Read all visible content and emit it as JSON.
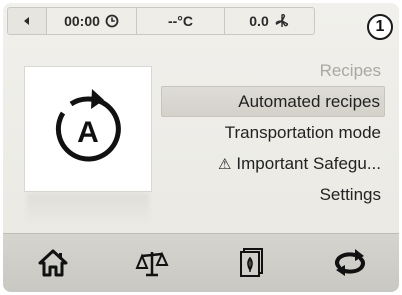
{
  "status_bar": {
    "timer": "00:00",
    "temperature": "--°C",
    "power": "0.0"
  },
  "step_badge": "1",
  "mode_tile": {
    "icon": "automated-mode-icon",
    "letter": "A"
  },
  "menu": {
    "items": [
      {
        "label": "Recipes"
      },
      {
        "label": "Automated recipes"
      },
      {
        "label": "Transportation mode"
      },
      {
        "label": "Important Safegu..."
      },
      {
        "label": "Settings"
      }
    ]
  },
  "icons": {
    "back": "back-arrow-icon",
    "timer": "clock-icon",
    "power": "fan-icon",
    "warning": "warning-icon",
    "home": "home-icon",
    "scale": "scale-icon",
    "recipes": "recipe-book-icon",
    "mode": "loop-icon"
  }
}
